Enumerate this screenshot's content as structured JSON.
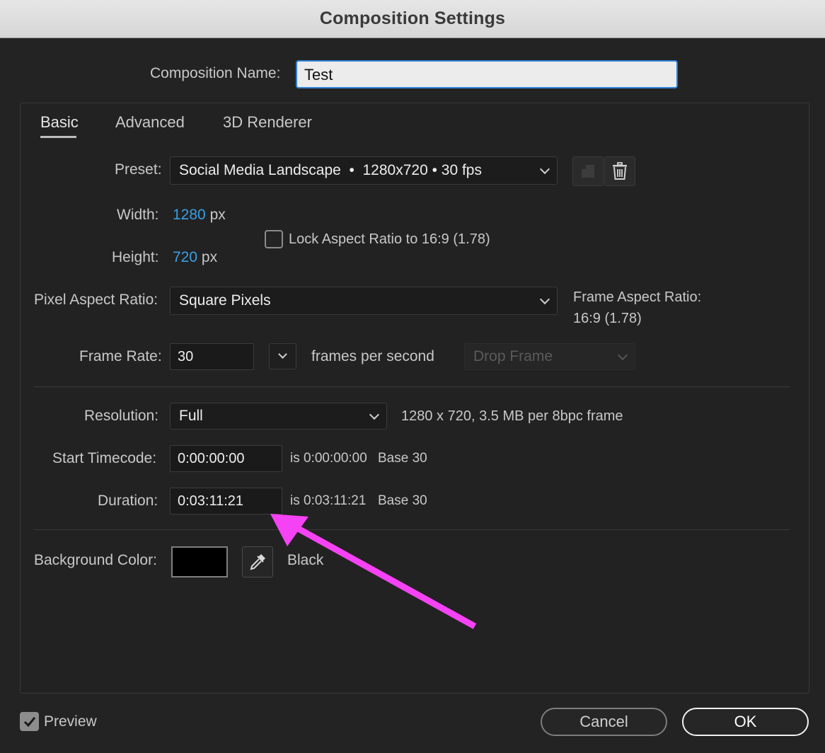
{
  "window": {
    "title": "Composition Settings"
  },
  "composition_name": {
    "label": "Composition Name:",
    "value": "Test"
  },
  "tabs": [
    {
      "label": "Basic",
      "active": true
    },
    {
      "label": "Advanced",
      "active": false
    },
    {
      "label": "3D Renderer",
      "active": false
    }
  ],
  "preset": {
    "label": "Preset:",
    "value": "Social Media Landscape  •  1280x720 • 30 fps"
  },
  "width": {
    "label": "Width:",
    "value": "1280",
    "unit": "px"
  },
  "height": {
    "label": "Height:",
    "value": "720",
    "unit": "px"
  },
  "lock_aspect": {
    "label": "Lock Aspect Ratio to 16:9 (1.78)",
    "checked": false
  },
  "pixel_aspect": {
    "label": "Pixel Aspect Ratio:",
    "value": "Square Pixels"
  },
  "frame_aspect": {
    "label": "Frame Aspect Ratio:",
    "value": "16:9 (1.78)"
  },
  "frame_rate": {
    "label": "Frame Rate:",
    "value": "30",
    "unit": "frames per second",
    "drop_frame": "Drop Frame"
  },
  "resolution": {
    "label": "Resolution:",
    "value": "Full",
    "info": "1280 x 720, 3.5 MB per 8bpc frame"
  },
  "start_timecode": {
    "label": "Start Timecode:",
    "value": "0:00:00:00",
    "is_text": "is 0:00:00:00",
    "base": "Base 30"
  },
  "duration": {
    "label": "Duration:",
    "value": "0:03:11:21",
    "is_text": "is 0:03:11:21",
    "base": "Base 30"
  },
  "background_color": {
    "label": "Background Color:",
    "color": "#000000",
    "name": "Black"
  },
  "footer": {
    "preview_label": "Preview",
    "preview_checked": true,
    "cancel_label": "Cancel",
    "ok_label": "OK"
  },
  "annotation": {
    "arrow_color": "#f542f5"
  },
  "colors": {
    "accent_blue": "#3a9fe6",
    "focus_border": "#2f82d6"
  }
}
